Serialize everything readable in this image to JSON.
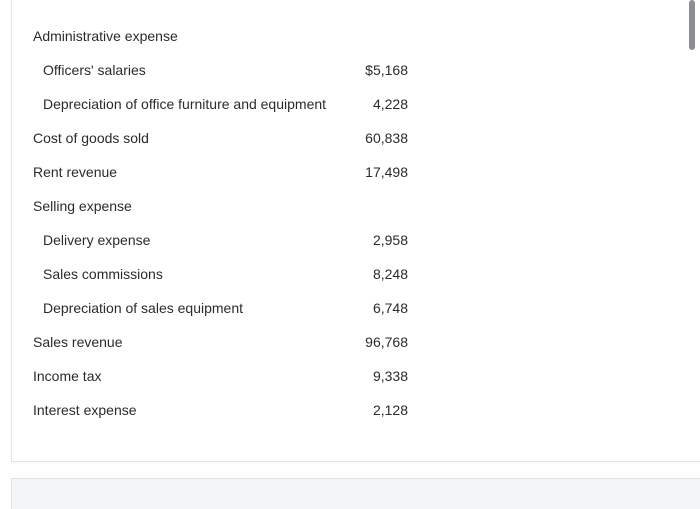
{
  "schedule": {
    "rows": [
      {
        "label": "Administrative expense",
        "amount": ""
      },
      {
        "label": "Officers' salaries",
        "amount": "$5,168"
      },
      {
        "label": "Depreciation of office furniture and equipment",
        "amount": "4,228"
      },
      {
        "label": "Cost of goods sold",
        "amount": "60,838"
      },
      {
        "label": "Rent revenue",
        "amount": "17,498"
      },
      {
        "label": "Selling expense",
        "amount": ""
      },
      {
        "label": "Delivery expense",
        "amount": "2,958"
      },
      {
        "label": "Sales commissions",
        "amount": "8,248"
      },
      {
        "label": "Depreciation of sales equipment",
        "amount": "6,748"
      },
      {
        "label": "Sales revenue",
        "amount": "96,768"
      },
      {
        "label": "Income tax",
        "amount": "9,338"
      },
      {
        "label": "Interest expense",
        "amount": "2,128"
      }
    ]
  },
  "colors": {
    "text": "#2b2b2b",
    "border": "#e1e3e6",
    "scrollbar": "#8b8e92",
    "bottom_band": "#f4f5f6"
  }
}
